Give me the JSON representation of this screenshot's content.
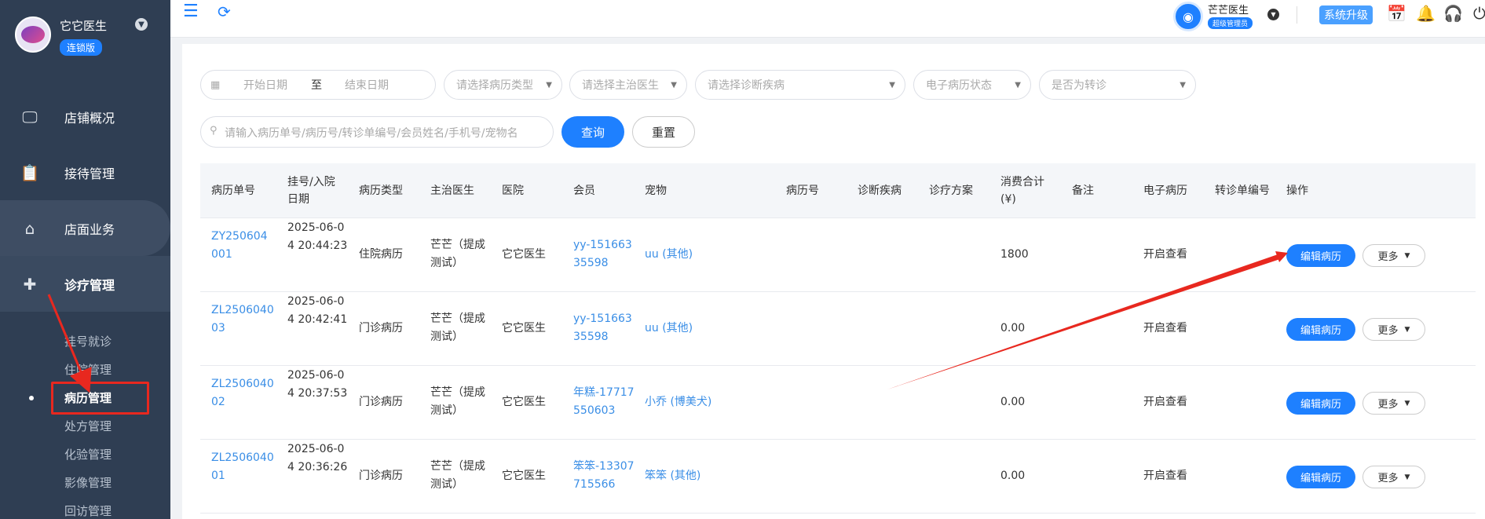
{
  "sidebar": {
    "clinic_name": "它它医生",
    "edition_badge": "连锁版",
    "menu": [
      {
        "label": "店铺概况",
        "icon": "monitor-icon"
      },
      {
        "label": "接待管理",
        "icon": "clipboard-icon"
      },
      {
        "label": "店面业务",
        "icon": "shop-icon"
      },
      {
        "label": "诊疗管理",
        "icon": "medical-kit-icon"
      }
    ],
    "submenu": [
      "挂号就诊",
      "住院管理",
      "病历管理",
      "处方管理",
      "化验管理",
      "影像管理",
      "回访管理"
    ],
    "active_submenu": "病历管理"
  },
  "topbar": {
    "user_name": "芒芒医生",
    "user_role": "超级管理员",
    "upgrade_label": "系统升级",
    "icons": [
      "menu-icon",
      "refresh-icon",
      "calendar-check-icon",
      "bell-icon",
      "headset-icon",
      "power-icon"
    ],
    "accent": "#1e80ff"
  },
  "filters": {
    "start_date": "开始日期",
    "to": "至",
    "end_date": "结束日期",
    "record_type": "请选择病历类型",
    "doctor": "请选择主治医生",
    "disease": "请选择诊断疾病",
    "emr_status": "电子病历状态",
    "referral": "是否为转诊",
    "search_placeholder": "请输入病历单号/病历号/转诊单编号/会员姓名/手机号/宠物名",
    "query_label": "查询",
    "reset_label": "重置"
  },
  "table": {
    "headers": {
      "no": "病历单号",
      "date": "挂号/入院日期",
      "type": "病历类型",
      "doctor": "主治医生",
      "hospital": "医院",
      "member": "会员",
      "pet": "宠物",
      "record_no": "病历号",
      "disease": "诊断疾病",
      "plan": "诊疗方案",
      "total": "消费合计(¥)",
      "remark": "备注",
      "emr": "电子病历",
      "referral_no": "转诊单编号",
      "ops": "操作"
    },
    "rows": [
      {
        "no": "ZY250604001",
        "date": "2025-06-04 20:44:23",
        "type": "住院病历",
        "doctor": "芒芒（提成测试）",
        "hospital": "它它医生",
        "member": "yy-15166335598",
        "pet": "uu (其他)",
        "total": "1800",
        "emr": "开启查看",
        "edit": "编辑病历",
        "more": "更多"
      },
      {
        "no": "ZL250604003",
        "date": "2025-06-04 20:42:41",
        "type": "门诊病历",
        "doctor": "芒芒（提成测试）",
        "hospital": "它它医生",
        "member": "yy-15166335598",
        "pet": "uu (其他)",
        "total": "0.00",
        "emr": "开启查看",
        "edit": "编辑病历",
        "more": "更多"
      },
      {
        "no": "ZL250604002",
        "date": "2025-06-04 20:37:53",
        "type": "门诊病历",
        "doctor": "芒芒（提成测试）",
        "hospital": "它它医生",
        "member": "年糕-17717550603",
        "pet": "小乔 (博美犬)",
        "total": "0.00",
        "emr": "开启查看",
        "edit": "编辑病历",
        "more": "更多"
      },
      {
        "no": "ZL250604001",
        "date": "2025-06-04 20:36:26",
        "type": "门诊病历",
        "doctor": "芒芒（提成测试）",
        "hospital": "它它医生",
        "member": "笨笨-13307715566",
        "pet": "笨笨 (其他)",
        "total": "0.00",
        "emr": "开启查看",
        "edit": "编辑病历",
        "more": "更多"
      }
    ]
  },
  "annotation_color": "#e8281f"
}
